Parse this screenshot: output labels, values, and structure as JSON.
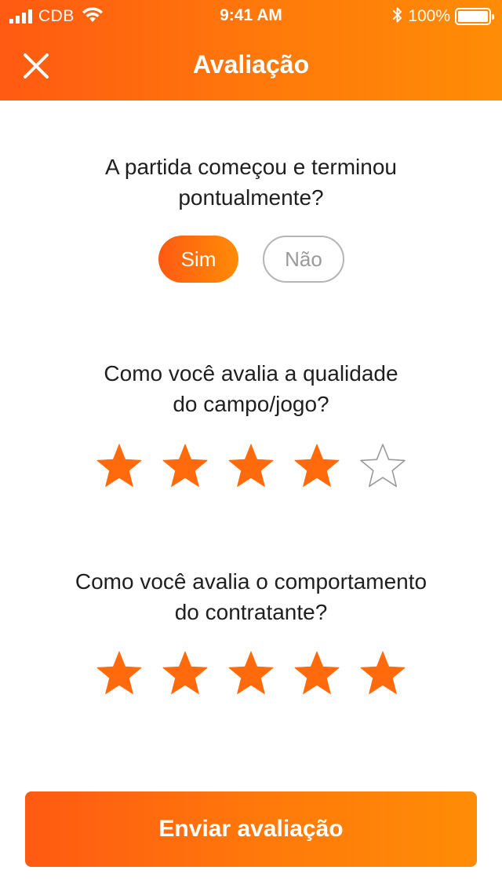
{
  "status_bar": {
    "carrier": "CDB",
    "time": "9:41 AM",
    "battery": "100%",
    "battery_level": 1.0
  },
  "nav": {
    "title": "Avaliação",
    "close_icon": "close-icon"
  },
  "question_punctuality": {
    "line1": "A partida começou e terminou",
    "line2": "pontualmente?",
    "options": [
      "Sim",
      "Não"
    ],
    "selected": "Sim"
  },
  "question_field_quality": {
    "line1": "Como você avalia a qualidade",
    "line2": "do campo/jogo?",
    "rating": 4,
    "max_rating": 5
  },
  "question_contractor_behavior": {
    "line1": "Como você avalia o comportamento",
    "line2": "do contratante?",
    "rating": 5,
    "max_rating": 5
  },
  "submit_button": {
    "label": "Enviar avaliação"
  },
  "colors": {
    "accent_start": "#ff5a12",
    "accent_end": "#ff8c06",
    "star_filled": "#ff6a0c",
    "star_empty_stroke": "#9a9a9a",
    "text": "#1f1f1f"
  }
}
